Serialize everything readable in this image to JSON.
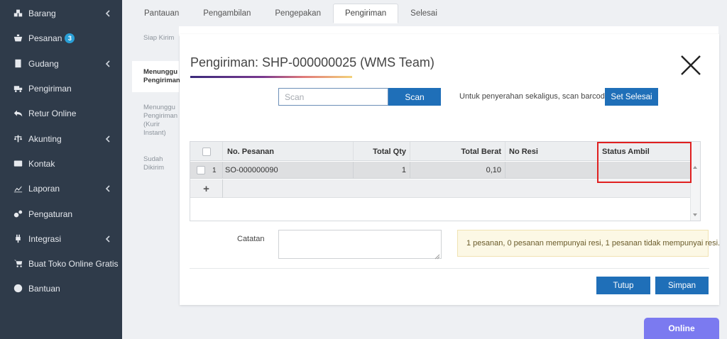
{
  "sidebar": {
    "items": [
      {
        "label": "Barang",
        "icon": "cubes-icon",
        "chevron": true
      },
      {
        "label": "Pesanan",
        "icon": "basket-icon",
        "badge": "3"
      },
      {
        "label": "Gudang",
        "icon": "building-icon",
        "chevron": true
      },
      {
        "label": "Pengiriman",
        "icon": "truck-icon"
      },
      {
        "label": "Retur Online",
        "icon": "reply-icon"
      },
      {
        "label": "Akunting",
        "icon": "scale-icon",
        "chevron": true
      },
      {
        "label": "Kontak",
        "icon": "id-card-icon"
      },
      {
        "label": "Laporan",
        "icon": "chart-icon",
        "chevron": true
      },
      {
        "label": "Pengaturan",
        "icon": "gears-icon"
      },
      {
        "label": "Integrasi",
        "icon": "plug-icon",
        "chevron": true
      },
      {
        "label": "Buat Toko Online Gratis",
        "icon": "cart-icon"
      },
      {
        "label": "Bantuan",
        "icon": "question-icon"
      }
    ]
  },
  "tabs": [
    "Pantauan",
    "Pengambilan",
    "Pengepakan",
    "Pengiriman",
    "Selesai"
  ],
  "active_tab": "Pengiriman",
  "subnav": [
    {
      "label": "Siap Kirim"
    },
    {
      "label": "Menunggu Pengiriman"
    },
    {
      "label": "Menunggu Pengiriman (Kurir Instant)"
    },
    {
      "label": "Sudah Dikirim"
    }
  ],
  "modal": {
    "title": "Pengiriman: SHP-000000025 (WMS Team)",
    "scan_placeholder": "Scan",
    "scan_button": "Scan",
    "hint": "Untuk penyerahan sekaligus, scan barcode ini",
    "set_button": "Set Selesai",
    "columns": [
      "No. Pesanan",
      "Total Qty",
      "Total Berat",
      "No Resi",
      "Status Ambil"
    ],
    "rows": [
      {
        "num": "1",
        "no_pesanan": "SO-000000090",
        "total_qty": "1",
        "total_berat": "0,10",
        "no_resi": "",
        "status_ambil": ""
      }
    ],
    "add_row": "+",
    "catatan_label": "Catatan",
    "info": "1 pesanan, 0 pesanan mempunyai resi, 1 pesanan tidak mempunyai resi.",
    "tutup": "Tutup",
    "simpan": "Simpan"
  },
  "online_label": "Online",
  "colors": {
    "sidebar_bg": "#2f3b4a",
    "primary": "#1f6fb8",
    "highlight": "#e02020",
    "online": "#7b7af0"
  }
}
